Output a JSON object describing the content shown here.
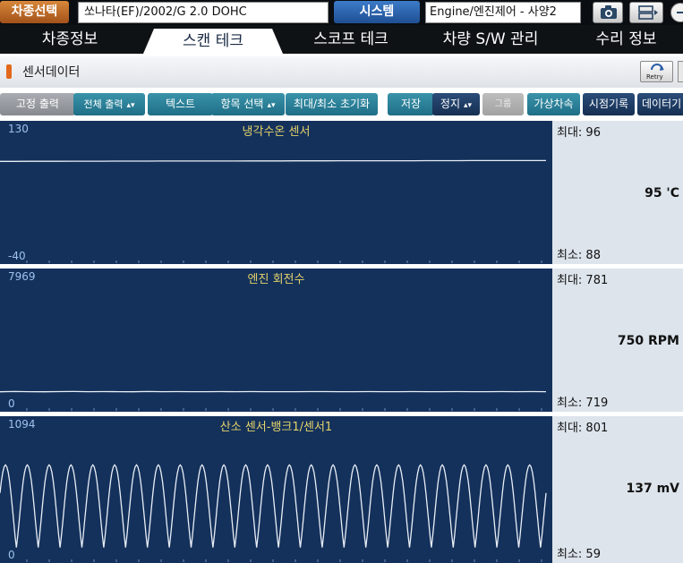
{
  "topbar": {
    "vehicle_button": "차종선택",
    "vehicle_value": "쏘나타(EF)/2002/G 2.0 DOHC",
    "system_button": "시스템",
    "system_value": "Engine/엔진제어 - 사양2"
  },
  "tabs": [
    {
      "label": "차종정보",
      "active": false
    },
    {
      "label": "스캔 테크",
      "active": true
    },
    {
      "label": "스코프 테크",
      "active": false
    },
    {
      "label": "차량 S/W 관리",
      "active": false
    },
    {
      "label": "수리 정보",
      "active": false
    }
  ],
  "section": {
    "title": "센서데이터",
    "retry_label": "Retry"
  },
  "toolbar": {
    "fixed_output": "고정 출력",
    "all_output": "전체 출력",
    "text": "텍스트",
    "item_select": "항목 선택",
    "minmax_reset": "최대/최소 초기화",
    "save": "저장",
    "stop": "정지",
    "group": "그룹",
    "virtual_speed": "가상차속",
    "time_record": "시점기록",
    "data_cut": "데이터기"
  },
  "colors": {
    "graph_bg": "#14315b",
    "trace": "#e8eef6",
    "axis_text": "#9fc1ee",
    "sensor_name": "#e4d36a",
    "value_panel_bg": "#dde4ec",
    "accent_orange": "#e2681b"
  },
  "sensors": [
    {
      "name": "냉각수온 센서",
      "axis_max": "130",
      "axis_min": "-40",
      "max_label": "최대: 96",
      "min_label": "최소: 88",
      "current": "95 'C",
      "range": [
        -40,
        130
      ],
      "samples": [
        94.9,
        94.9,
        95.0,
        95.0,
        95.0,
        95.1,
        95.1,
        95.1,
        95.2,
        95.2,
        95.2,
        95.3,
        95.3,
        95.3,
        95.4,
        95.4,
        95.4,
        95.5,
        95.5,
        95.5,
        95.6,
        95.6,
        95.6,
        95.7,
        95.7,
        95.7,
        95.8,
        95.8,
        95.8,
        95.9,
        95.9,
        95.9,
        96.0,
        96.0,
        96.0,
        96.0,
        96.0,
        96.0
      ]
    },
    {
      "name": "엔진 회전수",
      "axis_max": "7969",
      "axis_min": "0",
      "max_label": "최대: 781",
      "min_label": "최소: 719",
      "current": "750 RPM",
      "range": [
        0,
        7969
      ],
      "samples": [
        740,
        760,
        750,
        745,
        755,
        760,
        748,
        752,
        750,
        745,
        760,
        750,
        755,
        748,
        750,
        752,
        746,
        754,
        750,
        750,
        748,
        752,
        755,
        746,
        750,
        752,
        748,
        750,
        754,
        750,
        746,
        752,
        750,
        748,
        754,
        750,
        752,
        750
      ]
    },
    {
      "name": "산소 센서-뱅크1/센서1",
      "axis_max": "1094",
      "axis_min": "0",
      "max_label": "최대: 801",
      "min_label": "최소: 59",
      "current": "137 mV",
      "range": [
        0,
        1094
      ],
      "oscillation": {
        "low": 59,
        "high": 801,
        "cycles": 25
      }
    }
  ]
}
